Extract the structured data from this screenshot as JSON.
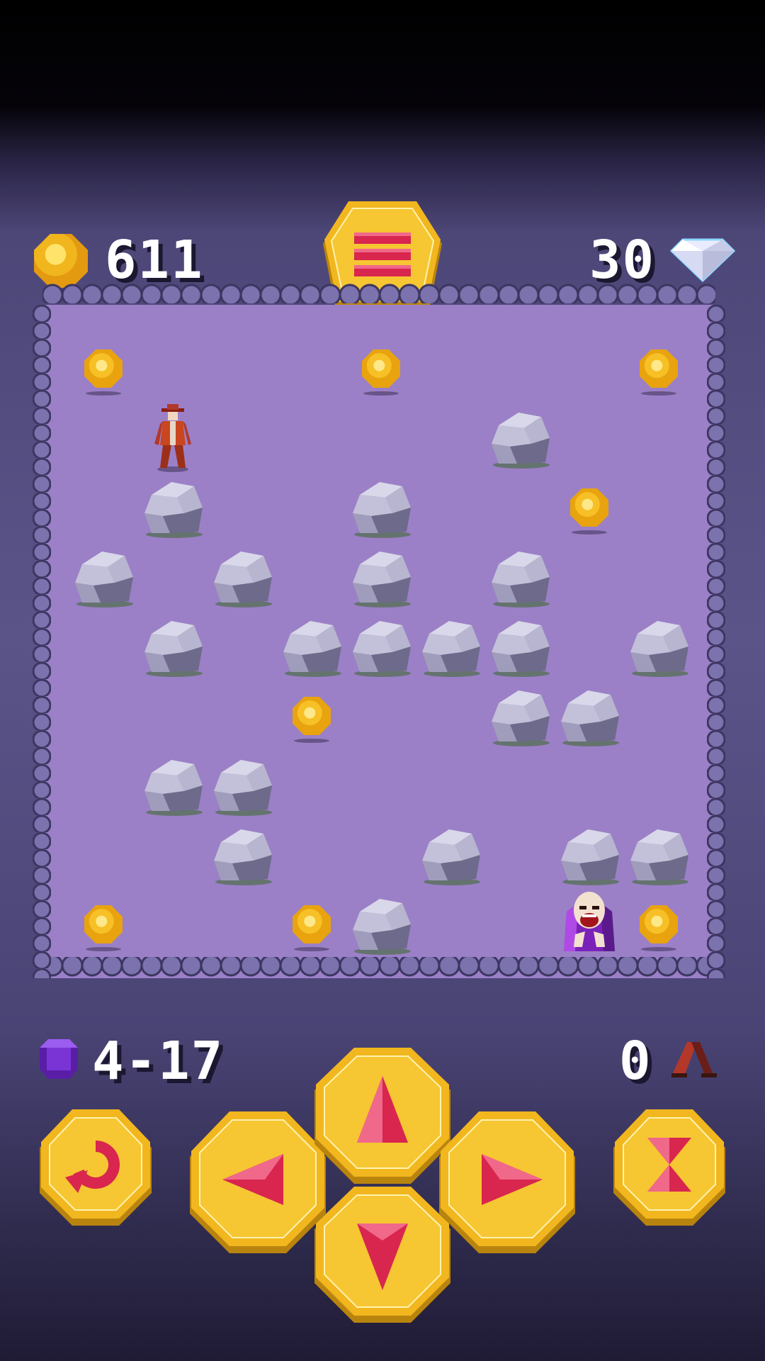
{
  "hud": {
    "coins": "611",
    "gems": "30",
    "level": "4-17",
    "steps": "0"
  },
  "colors": {
    "board": "#9b80c7",
    "gold": "#f2b71f",
    "ruby": "#d8264e",
    "rock": "#9a98b5"
  },
  "icons": {
    "menu": "menu-icon",
    "restart": "restart-icon",
    "up": "arrow-up-icon",
    "down": "arrow-down-icon",
    "left": "arrow-left-icon",
    "right": "arrow-right-icon",
    "wait": "hourglass-icon",
    "level": "purple-gem-icon",
    "steps": "footsteps-icon"
  },
  "board": {
    "columns": 9,
    "rows": 9,
    "player": [
      1,
      1
    ],
    "enemy": [
      7,
      8
    ],
    "rocks": [
      [
        6,
        1
      ],
      [
        1,
        2
      ],
      [
        4,
        2
      ],
      [
        0,
        3
      ],
      [
        2,
        3
      ],
      [
        4,
        3
      ],
      [
        6,
        3
      ],
      [
        1,
        4
      ],
      [
        3,
        4
      ],
      [
        4,
        4
      ],
      [
        5,
        4
      ],
      [
        6,
        4
      ],
      [
        8,
        4
      ],
      [
        6,
        5
      ],
      [
        7,
        5
      ],
      [
        1,
        6
      ],
      [
        2,
        6
      ],
      [
        2,
        7
      ],
      [
        5,
        7
      ],
      [
        7,
        7
      ],
      [
        8,
        7
      ],
      [
        4,
        8
      ]
    ],
    "coins": [
      [
        0,
        0
      ],
      [
        4,
        0
      ],
      [
        8,
        0
      ],
      [
        7,
        2
      ],
      [
        3,
        5
      ],
      [
        0,
        8
      ],
      [
        3,
        8
      ],
      [
        8,
        8
      ]
    ]
  }
}
